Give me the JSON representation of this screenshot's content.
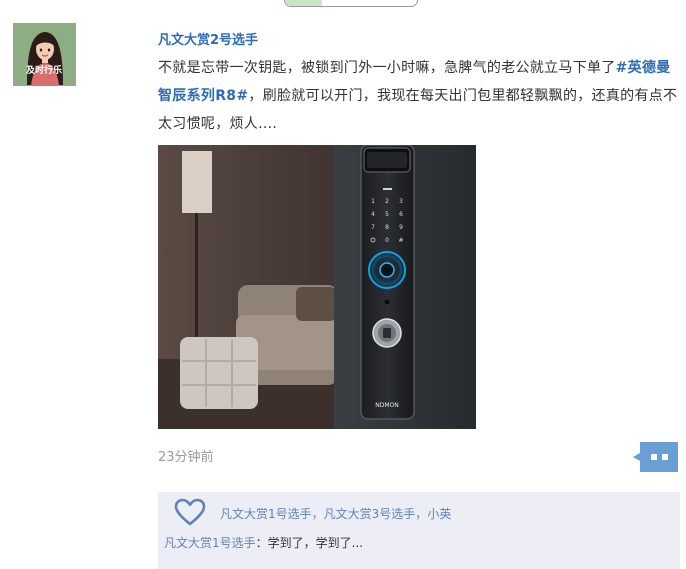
{
  "post": {
    "author": "凡文大赏2号选手",
    "avatar_caption": "及时行乐",
    "text_before": "不就是忘带一次钥匙，被锁到门外一小时嘛，急脾气的老公就立马下单了",
    "hashtag": "#英德曼智辰系列R8#",
    "text_after": "，刷脸就可以开门，我现在每天出门包里都轻飘飘的，还真的有点不太习惯呢，烦人....",
    "image_brand": "NDMON",
    "keypad": [
      "1",
      "2",
      "3",
      "4",
      "5",
      "6",
      "7",
      "8",
      "9",
      "0",
      "#"
    ],
    "timestamp": "23分钟前"
  },
  "likes": {
    "names": [
      "凡文大赏1号选手",
      "凡文大赏3号选手",
      "小英"
    ],
    "separator": "，"
  },
  "comment": {
    "author": "凡文大赏1号选手",
    "separator": "：",
    "text": "学到了，学到了..."
  },
  "colors": {
    "link_blue": "#2f6bb5",
    "like_blue": "#5d84b5",
    "interaction_bg": "#edeef5",
    "comment_button": "#6a9fd6"
  },
  "icons": {
    "like": "heart-icon",
    "comment": "comment-bubble-icon"
  }
}
